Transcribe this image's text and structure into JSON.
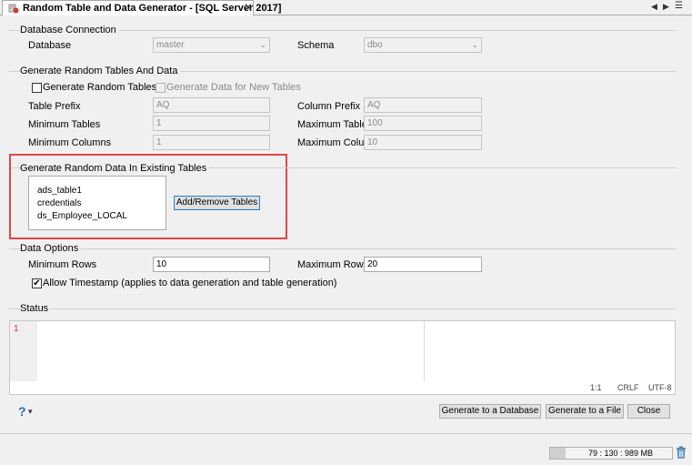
{
  "tab": {
    "title": "Random Table and Data Generator - [SQL Server 2017]",
    "close_glyph": "✕"
  },
  "nav": {
    "prev_glyph": "◀",
    "next_glyph": "▶",
    "menu_glyph": "☰"
  },
  "database_connection": {
    "group_label": "Database Connection",
    "database_label": "Database",
    "database_value": "master",
    "schema_label": "Schema",
    "schema_value": "dbo"
  },
  "generate_tables": {
    "group_label": "Generate Random Tables And Data",
    "generate_tables_label": "Generate Random Tables",
    "generate_tables_checked": false,
    "generate_data_label": "Generate Data for New Tables",
    "generate_data_checked": false,
    "table_prefix_label": "Table Prefix",
    "table_prefix_value": "AQ",
    "column_prefix_label": "Column Prefix",
    "column_prefix_value": "AQ",
    "min_tables_label": "Minimum Tables",
    "min_tables_value": "1",
    "max_tables_label": "Maximum Tables",
    "max_tables_value": "100",
    "min_columns_label": "Minimum Columns",
    "min_columns_value": "1",
    "max_columns_label": "Maximum Columns",
    "max_columns_value": "10"
  },
  "existing_tables": {
    "group_label": "Generate Random Data In Existing Tables",
    "items": [
      "ads_table1",
      "credentials",
      "ds_Employee_LOCAL"
    ],
    "add_remove_label": "Add/Remove Tables",
    "highlight_color": "#e04646"
  },
  "data_options": {
    "group_label": "Data Options",
    "min_rows_label": "Minimum Rows",
    "min_rows_value": "10",
    "max_rows_label": "Maximum Rows",
    "max_rows_value": "20",
    "allow_timestamp_label": "Allow Timestamp (applies to data generation and table generation)",
    "allow_timestamp_checked": true
  },
  "status": {
    "group_label": "Status",
    "line_number": "1",
    "cursor_pos": "1:1",
    "line_ending": "CRLF",
    "encoding": "UTF-8"
  },
  "footer": {
    "help_glyph": "?",
    "help_dropdown_glyph": "▾",
    "generate_db_label": "Generate to a Database",
    "generate_file_label": "Generate to a File",
    "close_label": "Close"
  },
  "memory": {
    "text": "79 : 130 : 989 MB",
    "used_fraction": 0.13
  }
}
